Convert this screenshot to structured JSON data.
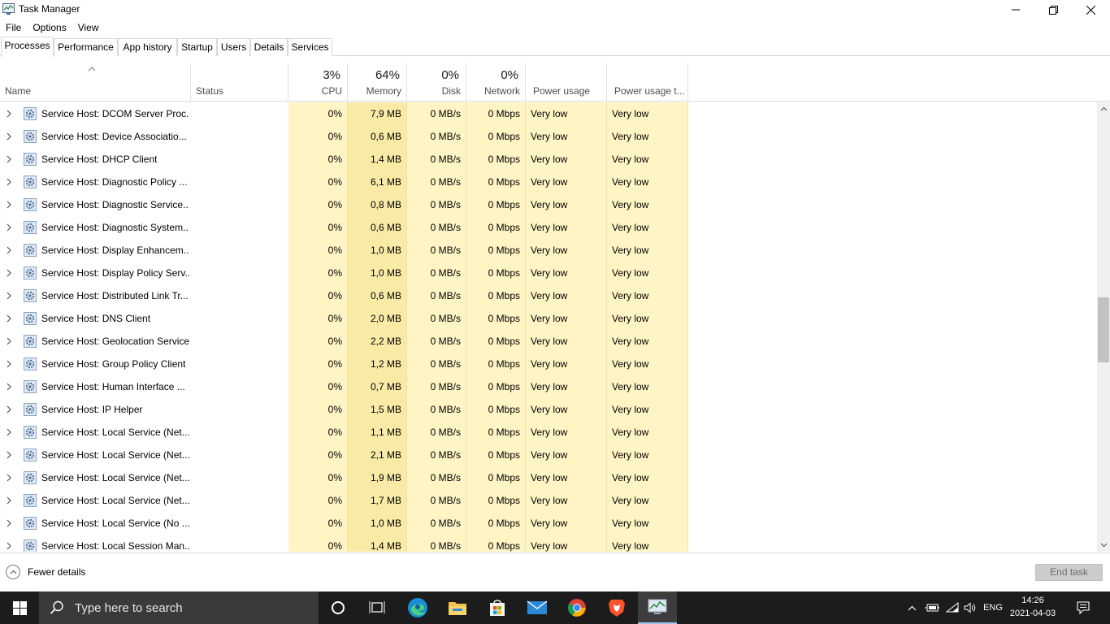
{
  "window": {
    "title": "Task Manager"
  },
  "menu": [
    "File",
    "Options",
    "View"
  ],
  "tabs": [
    "Processes",
    "Performance",
    "App history",
    "Startup",
    "Users",
    "Details",
    "Services"
  ],
  "columns": {
    "name": "Name",
    "status": "Status",
    "cpu": {
      "pct": "3%",
      "label": "CPU"
    },
    "memory": {
      "pct": "64%",
      "label": "Memory"
    },
    "disk": {
      "pct": "0%",
      "label": "Disk"
    },
    "network": {
      "pct": "0%",
      "label": "Network"
    },
    "power": "Power usage",
    "power_trend": "Power usage t..."
  },
  "rows": [
    {
      "name": "Service Host: DCOM Server Proc...",
      "cpu": "0%",
      "mem": "7,9 MB",
      "disk": "0 MB/s",
      "net": "0 Mbps",
      "power": "Very low",
      "trend": "Very low"
    },
    {
      "name": "Service Host: Device Associatio...",
      "cpu": "0%",
      "mem": "0,6 MB",
      "disk": "0 MB/s",
      "net": "0 Mbps",
      "power": "Very low",
      "trend": "Very low"
    },
    {
      "name": "Service Host: DHCP Client",
      "cpu": "0%",
      "mem": "1,4 MB",
      "disk": "0 MB/s",
      "net": "0 Mbps",
      "power": "Very low",
      "trend": "Very low"
    },
    {
      "name": "Service Host: Diagnostic Policy ...",
      "cpu": "0%",
      "mem": "6,1 MB",
      "disk": "0 MB/s",
      "net": "0 Mbps",
      "power": "Very low",
      "trend": "Very low"
    },
    {
      "name": "Service Host: Diagnostic Service...",
      "cpu": "0%",
      "mem": "0,8 MB",
      "disk": "0 MB/s",
      "net": "0 Mbps",
      "power": "Very low",
      "trend": "Very low"
    },
    {
      "name": "Service Host: Diagnostic System...",
      "cpu": "0%",
      "mem": "0,6 MB",
      "disk": "0 MB/s",
      "net": "0 Mbps",
      "power": "Very low",
      "trend": "Very low"
    },
    {
      "name": "Service Host: Display Enhancem...",
      "cpu": "0%",
      "mem": "1,0 MB",
      "disk": "0 MB/s",
      "net": "0 Mbps",
      "power": "Very low",
      "trend": "Very low"
    },
    {
      "name": "Service Host: Display Policy Serv...",
      "cpu": "0%",
      "mem": "1,0 MB",
      "disk": "0 MB/s",
      "net": "0 Mbps",
      "power": "Very low",
      "trend": "Very low"
    },
    {
      "name": "Service Host: Distributed Link Tr...",
      "cpu": "0%",
      "mem": "0,6 MB",
      "disk": "0 MB/s",
      "net": "0 Mbps",
      "power": "Very low",
      "trend": "Very low"
    },
    {
      "name": "Service Host: DNS Client",
      "cpu": "0%",
      "mem": "2,0 MB",
      "disk": "0 MB/s",
      "net": "0 Mbps",
      "power": "Very low",
      "trend": "Very low"
    },
    {
      "name": "Service Host: Geolocation Service",
      "cpu": "0%",
      "mem": "2,2 MB",
      "disk": "0 MB/s",
      "net": "0 Mbps",
      "power": "Very low",
      "trend": "Very low"
    },
    {
      "name": "Service Host: Group Policy Client",
      "cpu": "0%",
      "mem": "1,2 MB",
      "disk": "0 MB/s",
      "net": "0 Mbps",
      "power": "Very low",
      "trend": "Very low"
    },
    {
      "name": "Service Host: Human Interface ...",
      "cpu": "0%",
      "mem": "0,7 MB",
      "disk": "0 MB/s",
      "net": "0 Mbps",
      "power": "Very low",
      "trend": "Very low"
    },
    {
      "name": "Service Host: IP Helper",
      "cpu": "0%",
      "mem": "1,5 MB",
      "disk": "0 MB/s",
      "net": "0 Mbps",
      "power": "Very low",
      "trend": "Very low"
    },
    {
      "name": "Service Host: Local Service (Net...",
      "cpu": "0%",
      "mem": "1,1 MB",
      "disk": "0 MB/s",
      "net": "0 Mbps",
      "power": "Very low",
      "trend": "Very low"
    },
    {
      "name": "Service Host: Local Service (Net...",
      "cpu": "0%",
      "mem": "2,1 MB",
      "disk": "0 MB/s",
      "net": "0 Mbps",
      "power": "Very low",
      "trend": "Very low"
    },
    {
      "name": "Service Host: Local Service (Net...",
      "cpu": "0%",
      "mem": "1,9 MB",
      "disk": "0 MB/s",
      "net": "0 Mbps",
      "power": "Very low",
      "trend": "Very low"
    },
    {
      "name": "Service Host: Local Service (Net...",
      "cpu": "0%",
      "mem": "1,7 MB",
      "disk": "0 MB/s",
      "net": "0 Mbps",
      "power": "Very low",
      "trend": "Very low"
    },
    {
      "name": "Service Host: Local Service (No ...",
      "cpu": "0%",
      "mem": "1,0 MB",
      "disk": "0 MB/s",
      "net": "0 Mbps",
      "power": "Very low",
      "trend": "Very low"
    },
    {
      "name": "Service Host: Local Session Man...",
      "cpu": "0%",
      "mem": "1,4 MB",
      "disk": "0 MB/s",
      "net": "0 Mbps",
      "power": "Very low",
      "trend": "Very low"
    }
  ],
  "footer": {
    "fewer_details": "Fewer details",
    "end_task": "End task"
  },
  "taskbar": {
    "search_placeholder": "Type here to search",
    "language": "ENG",
    "time": "14:26",
    "date": "2021-04-03",
    "pinned": [
      "task-view-icon",
      "cortana-icon",
      "edge-icon",
      "file-explorer-icon",
      "store-icon",
      "mail-icon",
      "chrome-icon",
      "brave-icon",
      "task-manager-icon"
    ]
  },
  "colors": {
    "heat_light": "#fff4c4",
    "heat_mem": "#fcefb4",
    "taskbar": "#1c1c1c"
  }
}
